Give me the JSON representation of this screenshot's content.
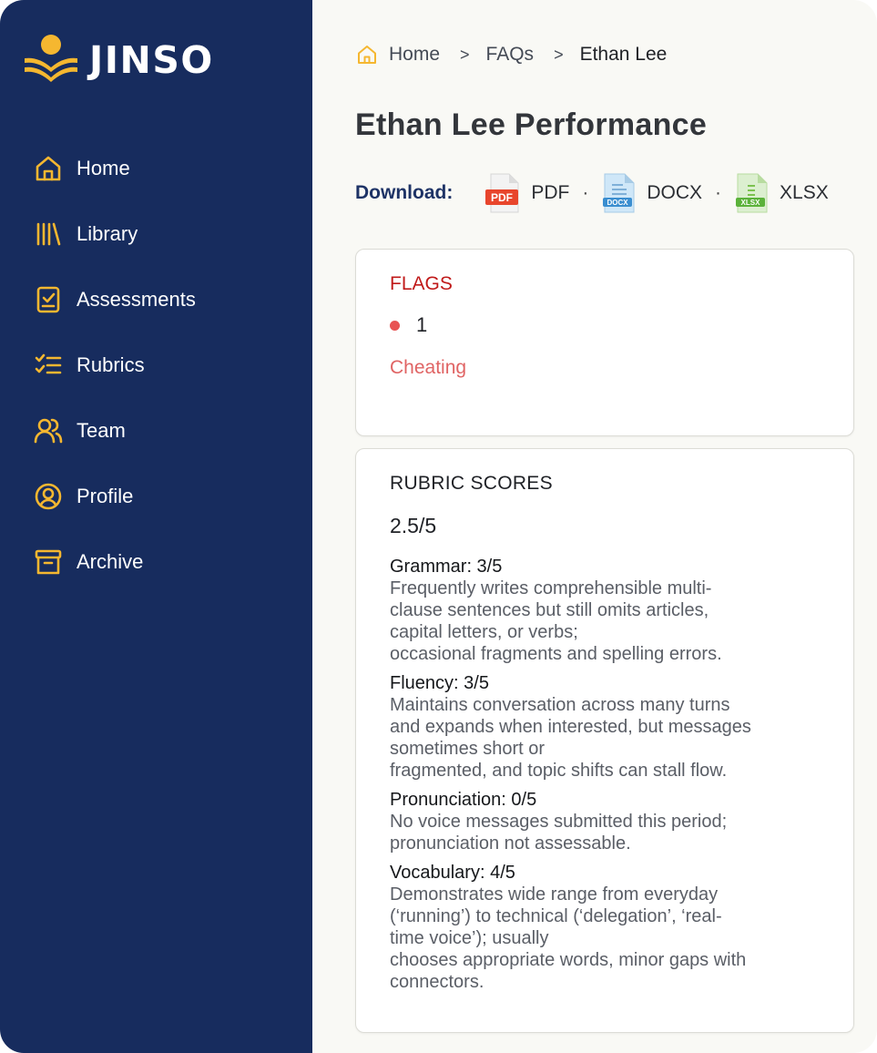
{
  "app": {
    "name": "JINSO"
  },
  "sidebar": {
    "items": [
      {
        "label": "Home",
        "icon": "home-icon"
      },
      {
        "label": "Library",
        "icon": "library-icon"
      },
      {
        "label": "Assessments",
        "icon": "clipboard-check-icon"
      },
      {
        "label": "Rubrics",
        "icon": "checklist-icon"
      },
      {
        "label": "Team",
        "icon": "team-icon"
      },
      {
        "label": "Profile",
        "icon": "profile-icon"
      },
      {
        "label": "Archive",
        "icon": "archive-icon"
      }
    ]
  },
  "breadcrumb": {
    "items": [
      "Home",
      "FAQs",
      "Ethan Lee"
    ]
  },
  "page": {
    "title": "Ethan Lee Performance"
  },
  "download": {
    "label": "Download:",
    "formats": [
      "PDF",
      "DOCX",
      "XLSX"
    ],
    "separator": "·"
  },
  "flags": {
    "title": "FLAGS",
    "count": "1",
    "items": [
      "Cheating"
    ]
  },
  "rubric": {
    "title": "RUBRIC SCORES",
    "total": "2.5/5",
    "criteria": [
      {
        "name": "Grammar: 3/5",
        "description": "Frequently writes comprehensible multi-\nclause sentences but still omits articles,\ncapital letters, or verbs;\noccasional fragments and spelling errors."
      },
      {
        "name": "Fluency: 3/5",
        "description": "Maintains conversation across many turns\nand expands when interested, but messages\nsometimes short or\nfragmented, and topic shifts can stall flow."
      },
      {
        "name": "Pronunciation: 0/5",
        "description": "No voice messages submitted this period;\npronunciation not assessable."
      },
      {
        "name": "Vocabulary: 4/5",
        "description": "Demonstrates wide range from everyday\n(‘running’) to technical (‘delegation’, ‘real-\ntime voice’); usually\nchooses appropriate words, minor gaps with\nconnectors."
      }
    ]
  },
  "colors": {
    "sidebar_bg": "#172c5e",
    "accent": "#f5b730",
    "flag_title": "#c01a1a",
    "flag_item": "#e06464",
    "download_label": "#1e3366"
  }
}
